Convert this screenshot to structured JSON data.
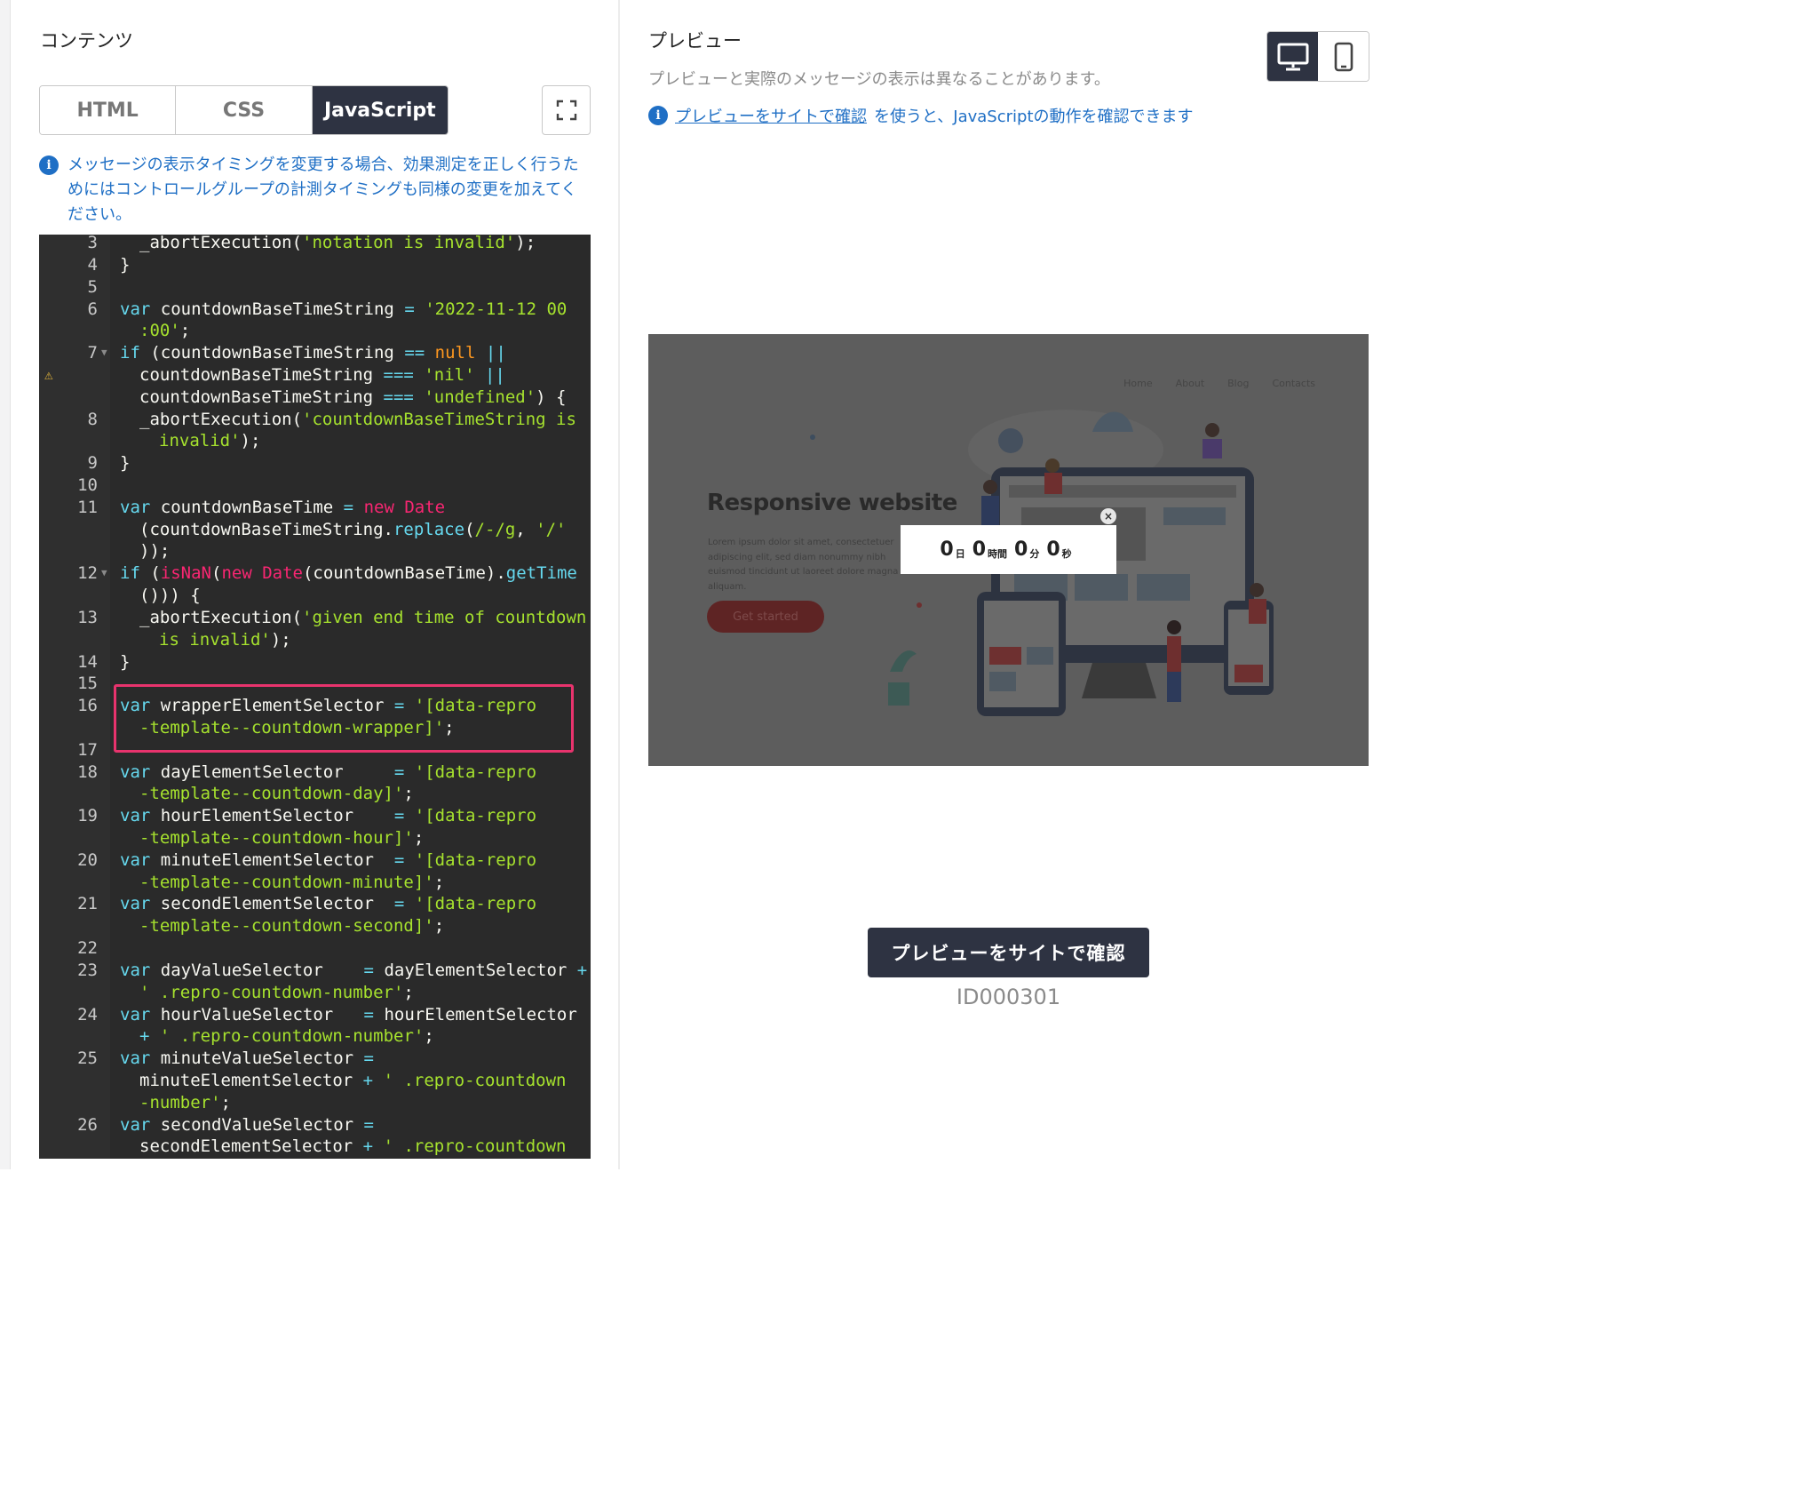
{
  "contents_panel": {
    "title": "コンテンツ",
    "tabs": [
      {
        "label": "HTML",
        "active": false
      },
      {
        "label": "CSS",
        "active": false
      },
      {
        "label": "JavaScript",
        "active": true
      }
    ],
    "fullscreen_icon": "expand-icon",
    "info_note": "メッセージの表示タイミングを変更する場合、効果測定を正しく行うためにはコントロールグループの計測タイミングも同様の変更を加えてください。"
  },
  "editor": {
    "line_numbers": [
      "3",
      "4",
      "5",
      "6",
      "7",
      "8",
      "9",
      "10",
      "11",
      "12",
      "13",
      "14",
      "15",
      "16",
      "17",
      "18",
      "19",
      "20",
      "21",
      "22",
      "23",
      "24",
      "25",
      "26"
    ],
    "code_text": [
      "_abortExecution('notation is invalid');",
      "}",
      "var countdownBaseTimeString = '2022-11-12 00",
      ":00';",
      "if (countdownBaseTimeString == null ||",
      "countdownBaseTimeString === 'nil' ||",
      "countdownBaseTimeString === 'undefined') {",
      "_abortExecution('countdownBaseTimeString is",
      "invalid');",
      "}",
      "var countdownBaseTime = new Date",
      "(countdownBaseTimeString.replace(/-/g, '/'",
      "));",
      "if (isNaN(new Date(countdownBaseTime).getTime",
      "())) {",
      "_abortExecution('given end time of countdown",
      "is invalid');",
      "}",
      "var wrapperElementSelector = '[data-repro",
      "-template--countdown-wrapper]';",
      "var dayElementSelector     = '[data-repro",
      "-template--countdown-day]';",
      "var hourElementSelector    = '[data-repro",
      "-template--countdown-hour]';",
      "var minuteElementSelector  = '[data-repro",
      "-template--countdown-minute]';",
      "var secondElementSelector  = '[data-repro",
      "-template--countdown-second]';",
      "var dayValueSelector    = dayElementSelector +",
      "' .repro-countdown-number';",
      "var hourValueSelector   = hourElementSelector",
      "+ ' .repro-countdown-number';",
      "var minuteValueSelector =",
      "minuteElementSelector + ' .repro-countdown",
      "-number';",
      "var secondValueSelector =",
      "secondElementSelector + ' .repro-countdown"
    ],
    "highlight_color": "#e8336d",
    "warning_icon": "warning-triangle-icon"
  },
  "preview_panel": {
    "title": "プレビュー",
    "note": "プレビューと実際のメッセージの表示は異なることがあります。",
    "link_label": "プレビューをサイトで確認",
    "link_suffix": "を使うと、JavaScriptの動作を確認できます",
    "device_toggle": [
      {
        "icon": "desktop-icon",
        "active": true
      },
      {
        "icon": "mobile-icon",
        "active": false
      }
    ],
    "mock_site": {
      "nav": [
        "Home",
        "About",
        "Blog",
        "Contacts"
      ],
      "headline": "Responsive website",
      "body": "Lorem ipsum dolor sit amet, consectetuer adipiscing elit, sed diam nonummy nibh euismod tincidunt ut laoreet dolore magna aliquam.",
      "cta": "Get started"
    },
    "countdown": {
      "days": "0",
      "days_unit": "日",
      "hours": "0",
      "hours_unit": "時間",
      "minutes": "0",
      "minutes_unit": "分",
      "seconds": "0",
      "seconds_unit": "秒",
      "close_icon": "close-icon"
    },
    "check_button": "プレビューをサイトで確認",
    "message_id": "ID000301"
  },
  "colors": {
    "primary_dark": "#2e3342",
    "link_blue": "#1f6fc5",
    "editor_bg": "#2a2a2a"
  }
}
